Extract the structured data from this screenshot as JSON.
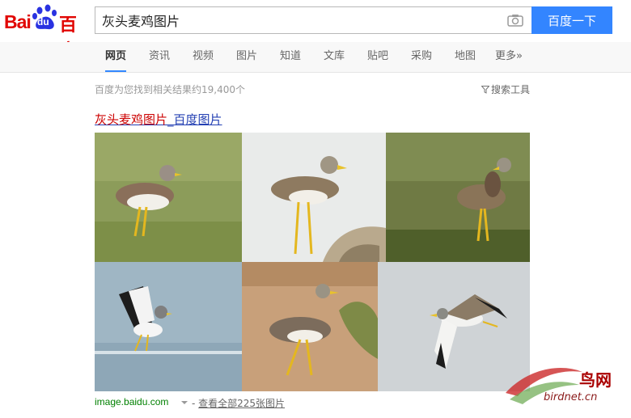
{
  "logo": {
    "text_latin": "Bai",
    "text_paw": "du",
    "text_cn": "百度"
  },
  "search": {
    "query": "灰头麦鸡图片",
    "button_label": "百度一下"
  },
  "tabs": [
    {
      "label": "网页",
      "active": true
    },
    {
      "label": "资讯"
    },
    {
      "label": "视频"
    },
    {
      "label": "图片"
    },
    {
      "label": "知道"
    },
    {
      "label": "文库"
    },
    {
      "label": "贴吧"
    },
    {
      "label": "采购"
    },
    {
      "label": "地图"
    },
    {
      "label": "更多»"
    }
  ],
  "results_meta": {
    "count_text": "百度为您找到相关结果约19,400个",
    "tools_label": "搜索工具"
  },
  "result": {
    "title_highlight": "灰头麦鸡图片",
    "title_rest": "_百度图片",
    "images": [
      {
        "name": "grass-standing",
        "bg": "#8a9a58"
      },
      {
        "name": "white-bg-standing",
        "bg": "#e8eae8"
      },
      {
        "name": "grass-dark-standing",
        "bg": "#5a6b33"
      },
      {
        "name": "water-wings-up",
        "bg": "#9fb5c2"
      },
      {
        "name": "sand-walking",
        "bg": "#c9a27a"
      },
      {
        "name": "flying",
        "bg": "#cfd3d6"
      }
    ],
    "source": "image.baidu.com",
    "view_all_prefix": "- ",
    "view_all": "查看全部225张图片"
  },
  "watermark": {
    "cn": "鸟网",
    "en": "birdnet.cn"
  },
  "colors": {
    "accent": "#3385ff",
    "brand_red": "#e10602",
    "link": "#2440b3",
    "source_green": "#008000"
  }
}
